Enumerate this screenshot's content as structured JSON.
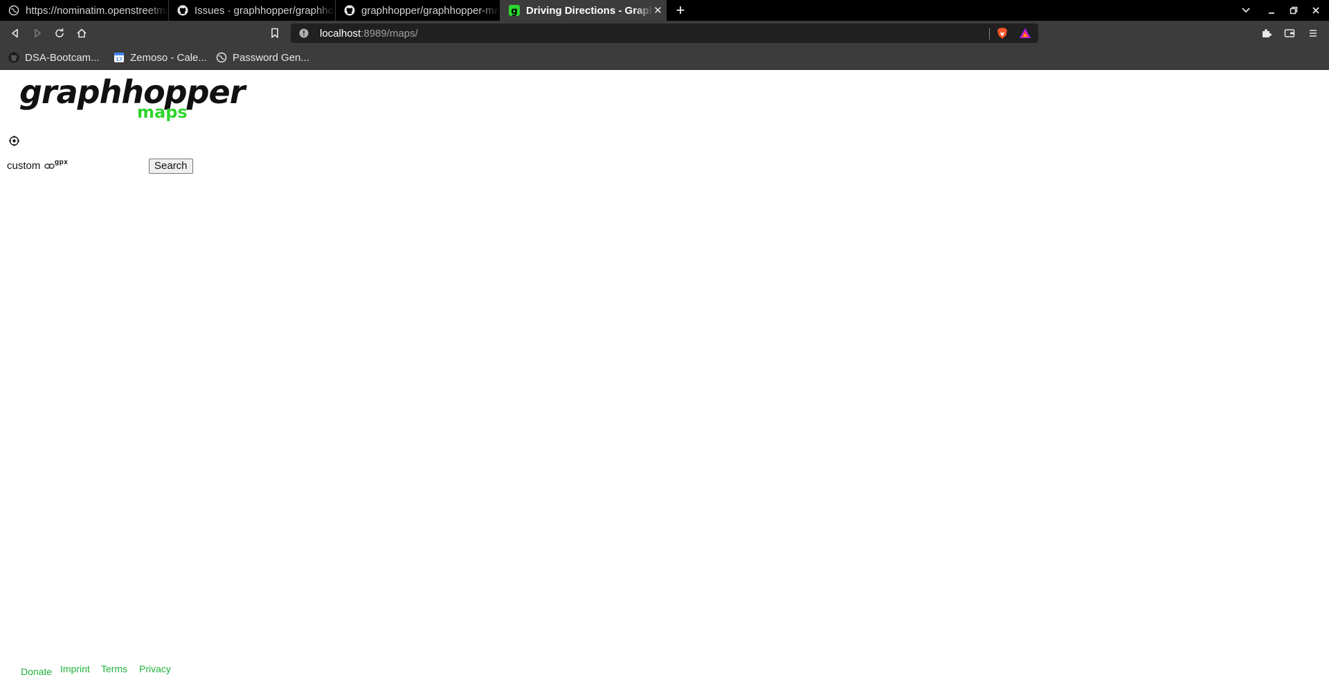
{
  "browser": {
    "tabs": [
      {
        "title": "https://nominatim.openstreetmap.org",
        "favicon": "globe-icon",
        "active": false
      },
      {
        "title": "Issues · graphhopper/graphhopper",
        "favicon": "github-icon",
        "active": false
      },
      {
        "title": "graphhopper/graphhopper-maps",
        "favicon": "github-icon",
        "active": false
      },
      {
        "title": "Driving Directions - GraphHopper Maps",
        "favicon": "graphhopper-icon",
        "active": true
      }
    ],
    "address": {
      "host": "localhost",
      "path": ":8989/maps/"
    },
    "bookmarks": [
      {
        "label": "DSA-Bootcam...",
        "icon": "github-icon"
      },
      {
        "label": "Zemoso - Cale...",
        "icon": "calendar-icon"
      },
      {
        "label": "Password Gen...",
        "icon": "globe-icon"
      }
    ]
  },
  "page": {
    "logo": {
      "word": "graphhopper",
      "sub": "maps"
    },
    "custom_label": "custom",
    "gpx_label": "gpx",
    "search_button": "Search",
    "footer": [
      "Donate",
      "Imprint",
      "Terms",
      "Privacy"
    ]
  },
  "colors": {
    "accent_green": "#2ed52e",
    "link_green": "#20b13a",
    "chrome_dark": "#3c3c3c",
    "tabbar_bg": "#000000"
  }
}
